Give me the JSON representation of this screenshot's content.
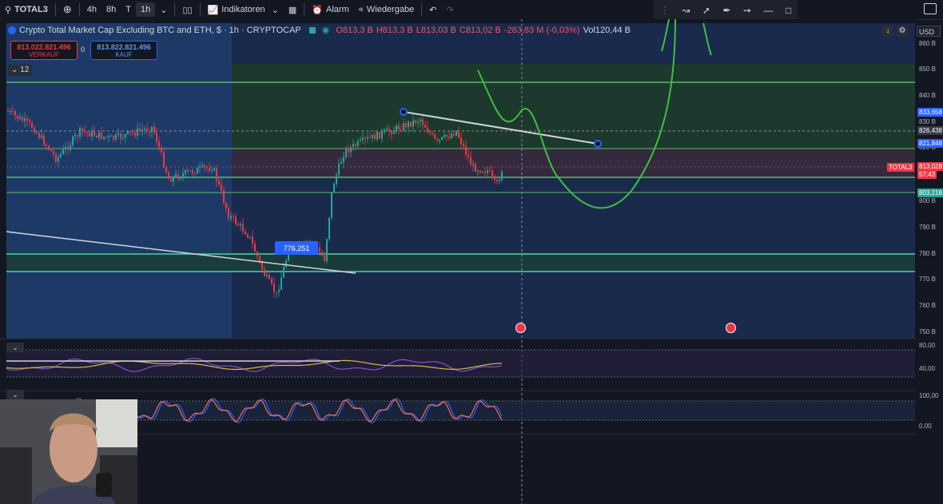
{
  "toolbar": {
    "symbol": "TOTAL3",
    "intervals": [
      "4h",
      "8h",
      "T",
      "1h"
    ],
    "indicators_label": "Indikatoren",
    "alarm_label": "Alarm",
    "replay_label": "Wiedergabe"
  },
  "legend": {
    "title": "Crypto Total Market Cap Excluding BTC and ETH, $ · 1h · CRYPTOCAP",
    "open": "O813,3 B",
    "high": "H813,3 B",
    "low": "L813,03 B",
    "close": "C813,02 B",
    "change": "-283,83 M (-0,03%)",
    "volume": "Vol120,44 B"
  },
  "trade": {
    "sell_price": "813.022.821.496",
    "sell_label": "VERKAUF",
    "spread": "0",
    "buy_price": "813.822.821.496",
    "buy_label": "KAUF"
  },
  "collapse_count": "12",
  "currency": "USD",
  "price_axis": {
    "ticks": [
      "860 B",
      "850 B",
      "840 B",
      "830 B",
      "820 B",
      "800 B",
      "790 B",
      "780 B",
      "770 B",
      "760 B",
      "750 B"
    ],
    "tags": {
      "high": "833,658",
      "crosshair": "826,438",
      "line": "821,848",
      "symbol": "TOTAL3",
      "last": "813,028",
      "countdown": "57:43",
      "support": "803,218"
    }
  },
  "chart_label": "776,251",
  "rsi_axis": [
    "80,00",
    "40,00"
  ],
  "stoch_axis": [
    "100,00",
    "0,00"
  ],
  "colors": {
    "up": "#26a69a",
    "down": "#f23645",
    "accent": "#2962ff",
    "zone_green": "#1b3a2a",
    "zone_blue": "#1c2a4a",
    "hand_drawn": "#3fbf3f"
  }
}
